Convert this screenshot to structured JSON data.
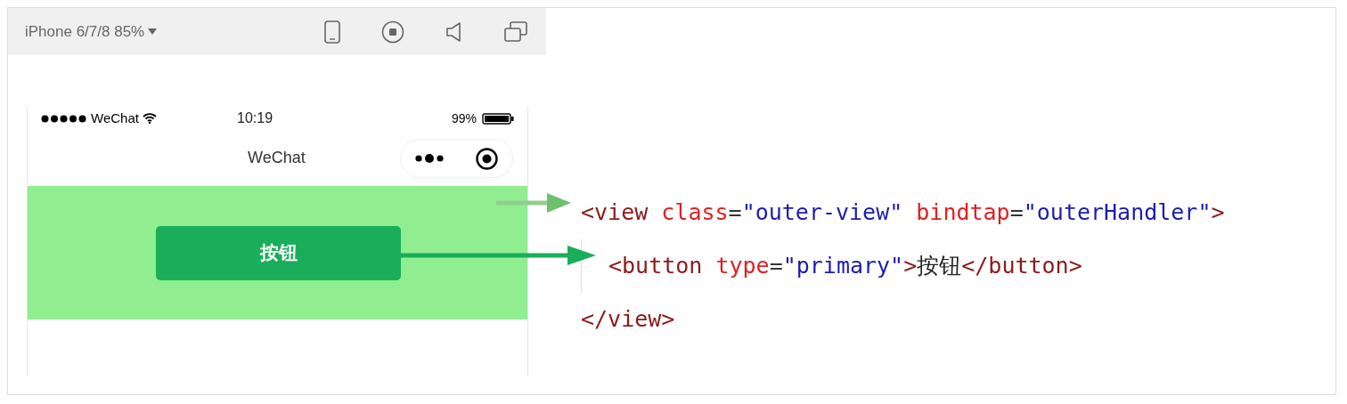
{
  "toolbar": {
    "device": "iPhone 6/7/8 85%"
  },
  "phone": {
    "status_bar": {
      "carrier": "WeChat",
      "time": "10:19",
      "battery": "99%"
    },
    "nav_title": "WeChat",
    "button": "按钮"
  },
  "code": {
    "tokens": [
      {
        "kind": "tag",
        "text": "<view "
      },
      {
        "kind": "attr",
        "text": "class"
      },
      {
        "kind": "punct",
        "text": "="
      },
      {
        "kind": "value",
        "text": "\"outer-view\" "
      },
      {
        "kind": "attr",
        "text": "bindtap"
      },
      {
        "kind": "punct",
        "text": "="
      },
      {
        "kind": "value",
        "text": "\"outerHandler\""
      },
      {
        "kind": "tag",
        "text": ">"
      }
    ],
    "children": [
      {
        "tokens": [
          {
            "kind": "tag",
            "text": "<button "
          },
          {
            "kind": "attr",
            "text": "type"
          },
          {
            "kind": "punct",
            "text": "="
          },
          {
            "kind": "value",
            "text": "\"primary\""
          },
          {
            "kind": "tag",
            "text": ">"
          },
          {
            "kind": "text",
            "text": "按钮"
          },
          {
            "kind": "tag",
            "text": "</button>"
          }
        ]
      }
    ],
    "close_tokens": [
      {
        "kind": "tag",
        "text": "</view>"
      }
    ]
  }
}
